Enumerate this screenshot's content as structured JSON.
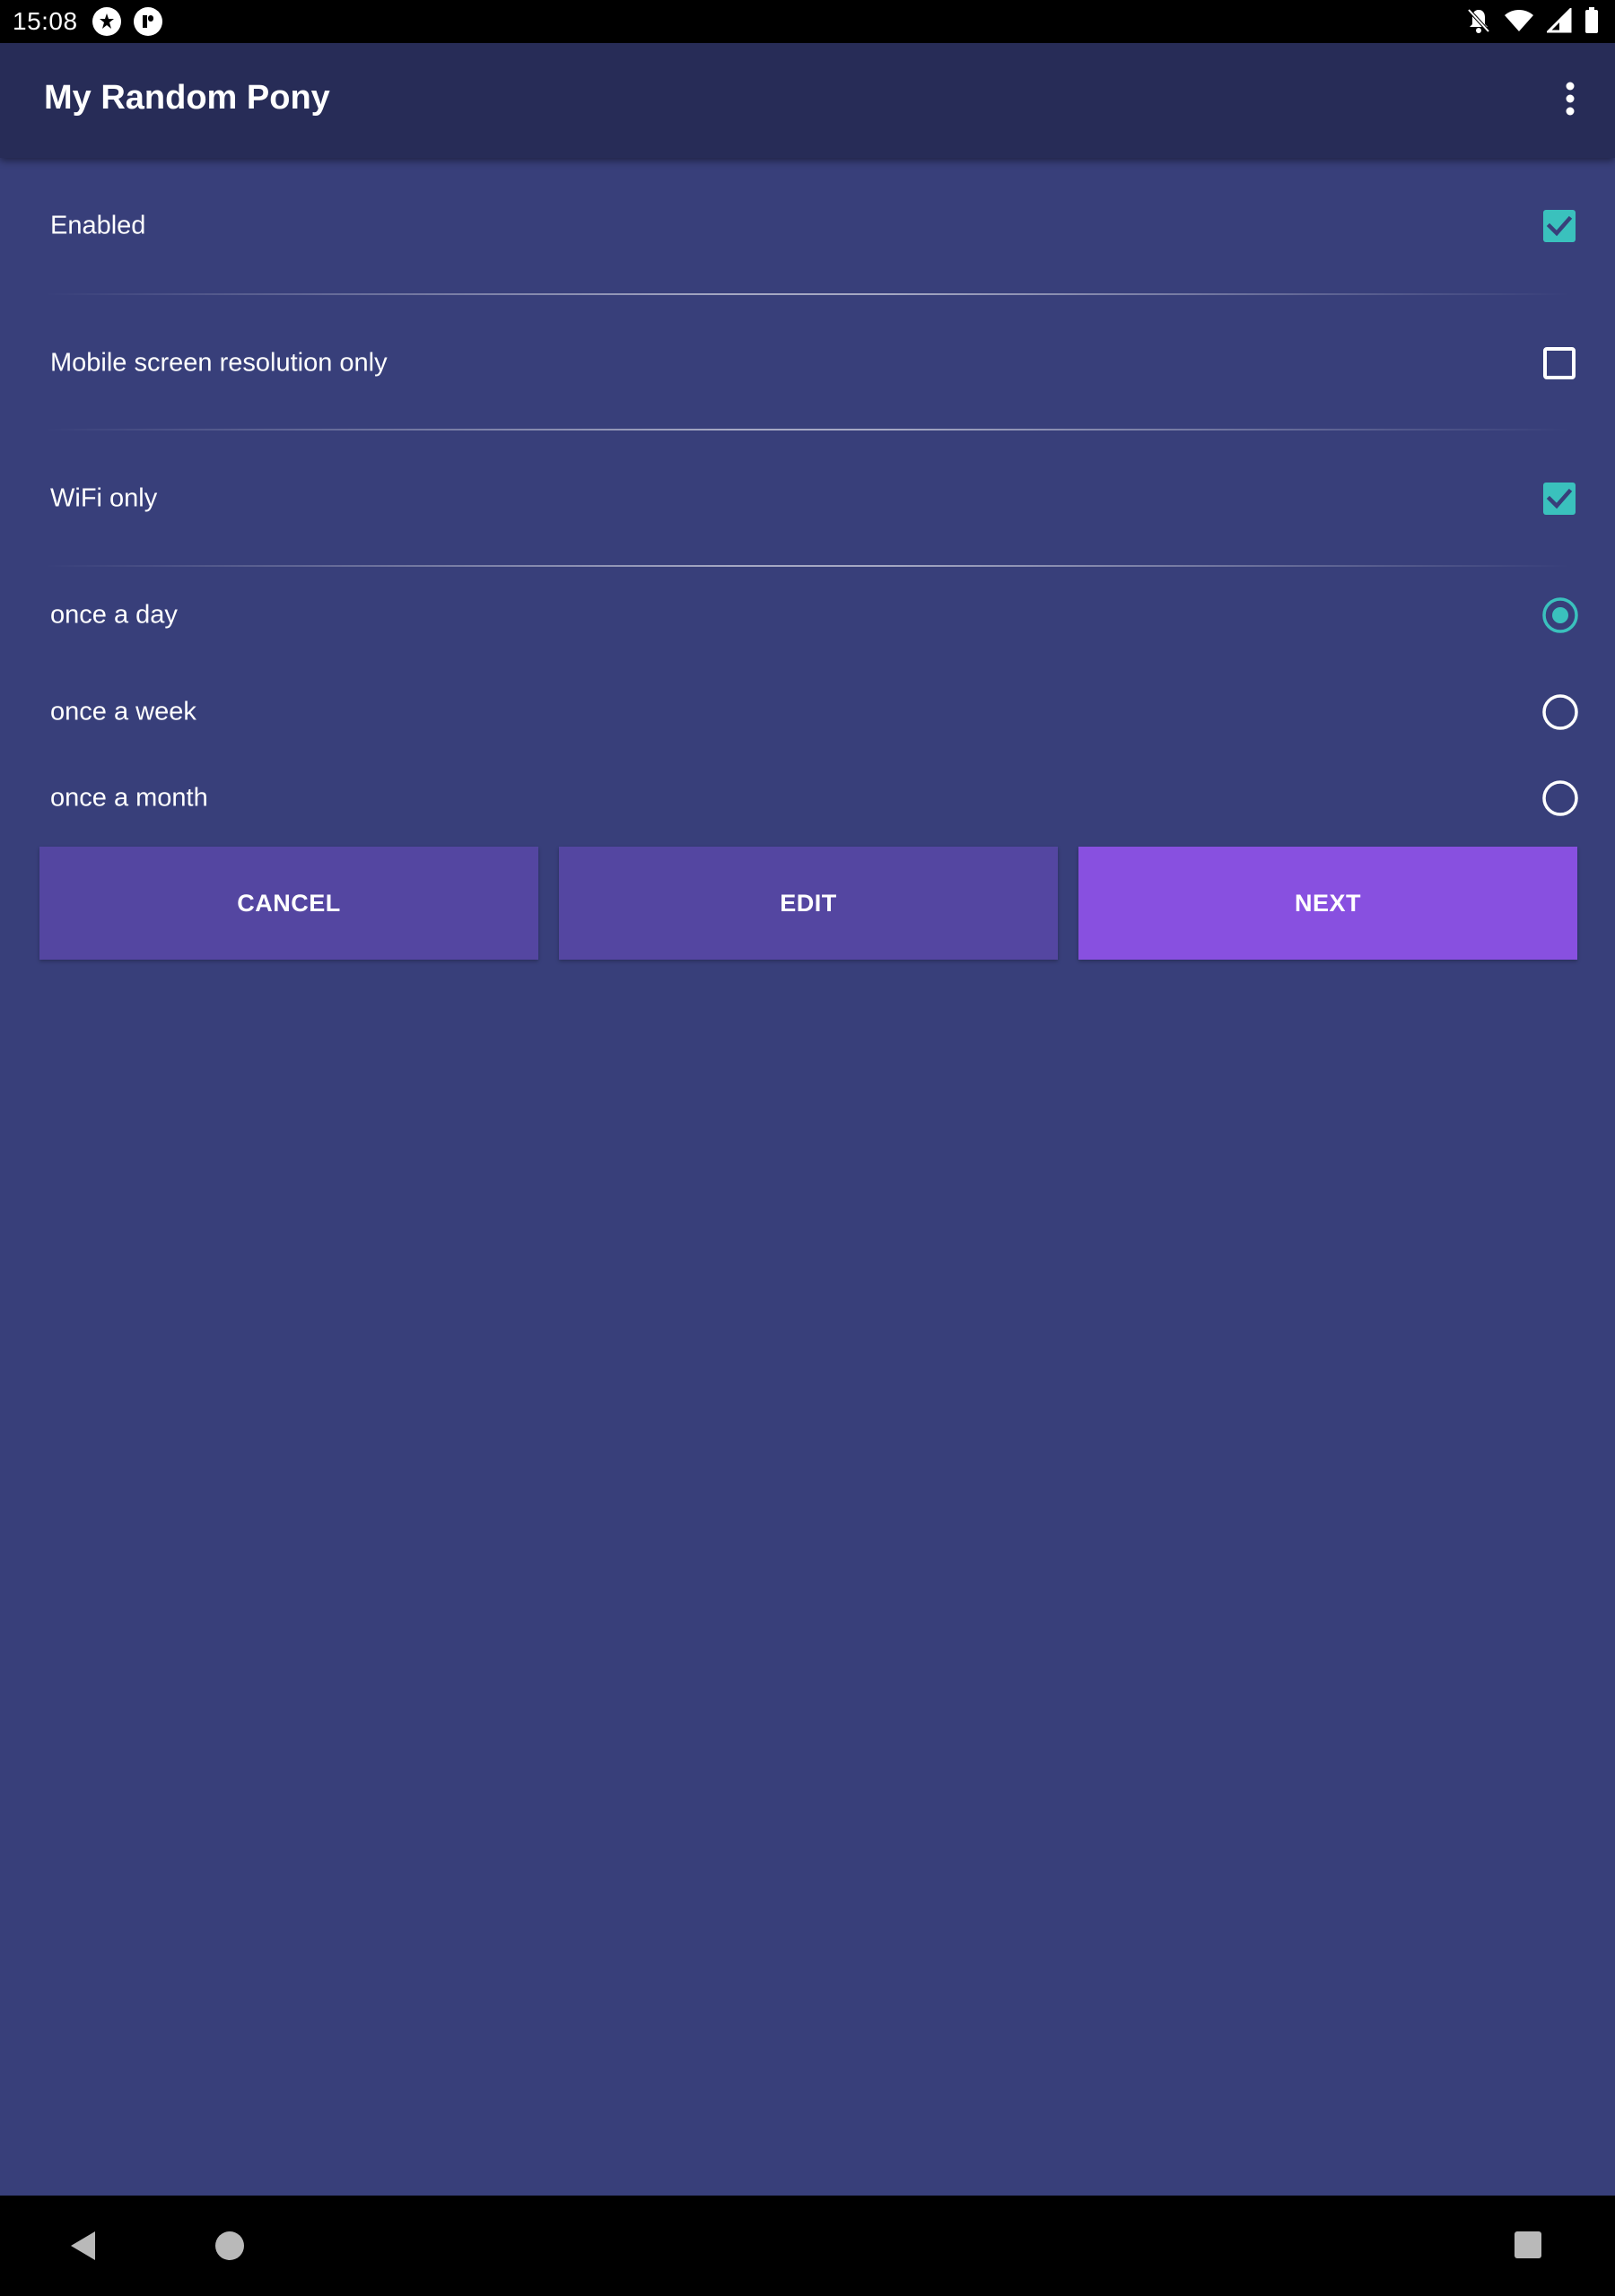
{
  "status_bar": {
    "time": "15:08",
    "left_icons": [
      "app-notification-icon",
      "app-notification-icon-2"
    ],
    "right_icons": [
      "notifications-off-icon",
      "wifi-icon",
      "signal-icon",
      "battery-icon"
    ]
  },
  "app_bar": {
    "title": "My Random Pony",
    "overflow_icon": "more-vert-icon"
  },
  "preferences": [
    {
      "label": "Enabled",
      "checked": true
    },
    {
      "label": "Mobile screen resolution only",
      "checked": false
    },
    {
      "label": "WiFi only",
      "checked": true
    }
  ],
  "frequency": {
    "options": [
      {
        "label": "once a day",
        "selected": true
      },
      {
        "label": "once a week",
        "selected": false
      },
      {
        "label": "once a month",
        "selected": false
      }
    ]
  },
  "buttons": {
    "cancel": "CANCEL",
    "edit": "EDIT",
    "next": "NEXT"
  },
  "colors": {
    "background": "#383f7a",
    "app_bar": "#272c57",
    "accent": "#3ac1bd",
    "button": "#5446a1",
    "button_primary": "#8850e0"
  },
  "nav_bar": {
    "icons": [
      "back-icon",
      "home-icon",
      "recents-icon"
    ]
  }
}
